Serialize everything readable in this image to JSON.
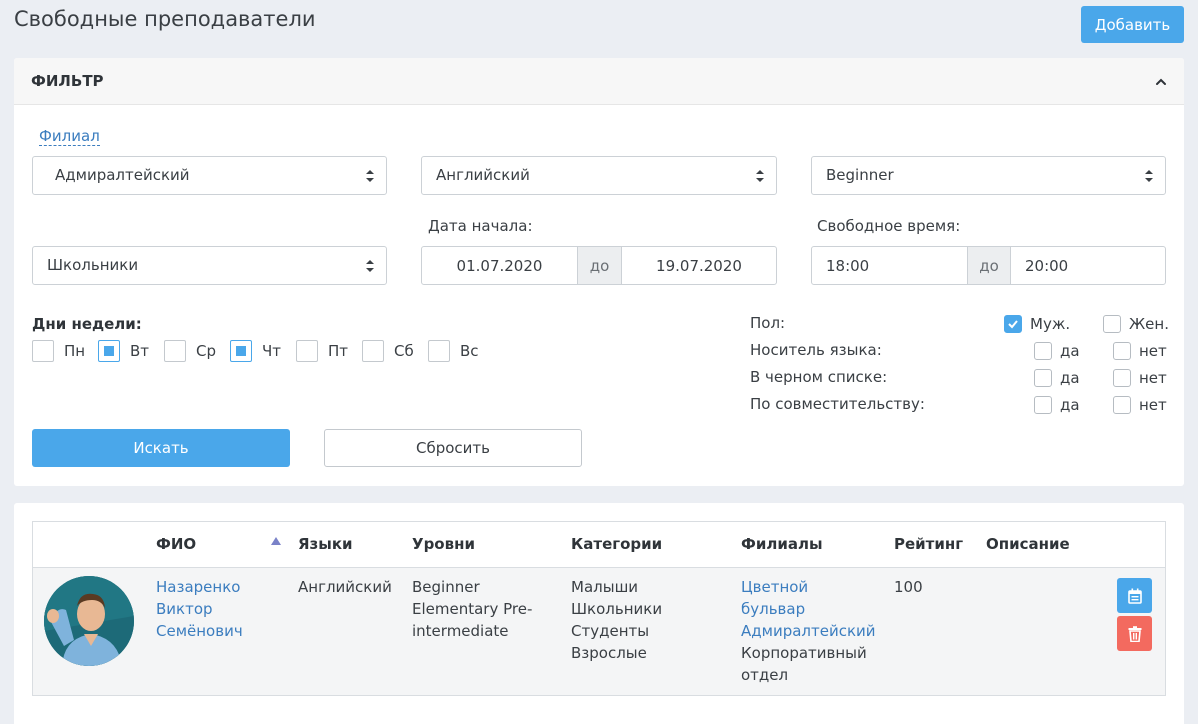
{
  "header": {
    "title": "Свободные преподаватели",
    "add_label": "Добавить"
  },
  "filter": {
    "title": "ФИЛЬТР",
    "branch_link": "Филиал",
    "branch_value": "Адмиралтейский",
    "language_value": "Английский",
    "level_value": "Beginner",
    "category_value": "Школьники",
    "date_label": "Дата начала:",
    "date_from": "01.07.2020",
    "date_sep": "до",
    "date_to": "19.07.2020",
    "time_label": "Свободное время:",
    "time_from": "18:00",
    "time_sep": "до",
    "time_to": "20:00",
    "days_title": "Дни недели:",
    "days": [
      {
        "label": "Пн",
        "checked": false
      },
      {
        "label": "Вт",
        "checked": true
      },
      {
        "label": "Ср",
        "checked": false
      },
      {
        "label": "Чт",
        "checked": true
      },
      {
        "label": "Пт",
        "checked": false
      },
      {
        "label": "Сб",
        "checked": false
      },
      {
        "label": "Вс",
        "checked": false
      }
    ],
    "gender_label": "Пол:",
    "gender_male": "Муж.",
    "gender_female": "Жен.",
    "native_label": "Носитель языка:",
    "blacklist_label": "В черном списке:",
    "parttime_label": "По совместительству:",
    "yes": "да",
    "no": "нет",
    "search_label": "Искать",
    "reset_label": "Сбросить"
  },
  "table": {
    "columns": [
      "ФИО",
      "Языки",
      "Уровни",
      "Категории",
      "Филиалы",
      "Рейтинг",
      "Описание"
    ],
    "rows": [
      {
        "name": [
          "Назаренко",
          "Виктор",
          "Семёнович"
        ],
        "languages": "Английский",
        "levels": [
          "Beginner",
          "Elementary Pre-",
          "intermediate"
        ],
        "categories": [
          "Малыши",
          "Школьники",
          "Студенты",
          "Взрослые"
        ],
        "branches_links": [
          "Цветной",
          "бульвар",
          "Адмиралтейский"
        ],
        "branches_plain": [
          "Корпоративный",
          "отдел"
        ],
        "rating": "100",
        "description": ""
      }
    ]
  },
  "colors": {
    "accent": "#4aa7ea",
    "danger": "#f36a5f",
    "link": "#3b7dbf",
    "background": "#ebeef3"
  }
}
